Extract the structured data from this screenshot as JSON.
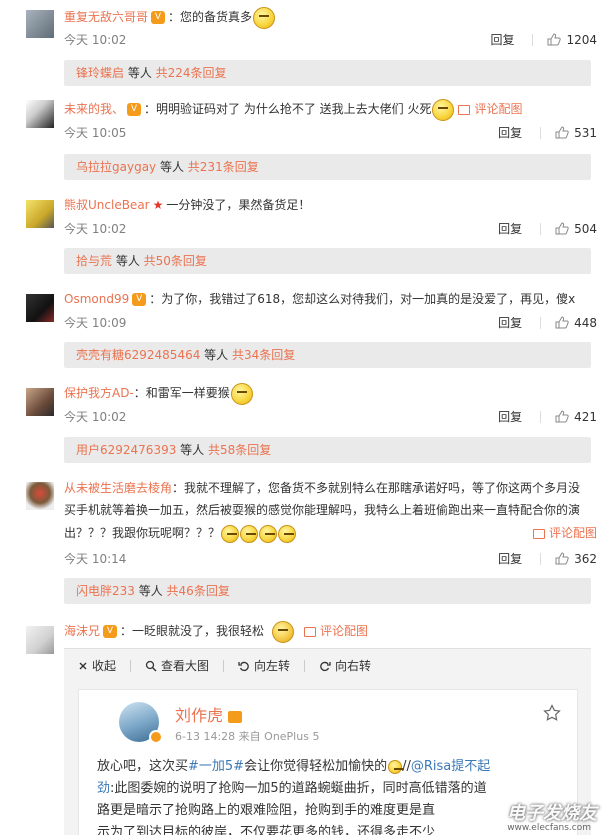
{
  "comments": [
    {
      "user": "重复无敌六哥哥",
      "text": "：您的备货真多",
      "time": "今天 10:02",
      "reply": "回复",
      "likes": "1204",
      "sub": {
        "user": "锋玲蝶启",
        "mid": " 等人 ",
        "count": "共224条回复"
      }
    },
    {
      "user": "未来的我、",
      "text": "：明明验证码对了 为什么抢不了 送我上去大佬们 火死",
      "pic_label": "评论配图",
      "time": "今天 10:05",
      "reply": "回复",
      "likes": "531",
      "sub": {
        "user": "乌拉拉gaygay",
        "mid": " 等人 ",
        "count": "共231条回复"
      }
    },
    {
      "user": "熊叔UncleBear",
      "text": "一分钟没了，果然备货足！",
      "time": "今天 10:02",
      "reply": "回复",
      "likes": "504",
      "sub": {
        "user": "拾与荒",
        "mid": " 等人 ",
        "count": "共50条回复"
      }
    },
    {
      "user": "Osmond99",
      "text": "：为了你，我错过了618，您却这么对待我们，对一加真的是没爱了，再见，傻x",
      "time": "今天 10:09",
      "reply": "回复",
      "likes": "448",
      "sub": {
        "user": "壳壳有糖6292485464",
        "mid": " 等人 ",
        "count": "共34条回复"
      }
    },
    {
      "user": "保护我方AD-",
      "text": "：和雷军一样要猴",
      "time": "今天 10:02",
      "reply": "回复",
      "likes": "421",
      "sub": {
        "user": "用户6292476393",
        "mid": " 等人 ",
        "count": "共58条回复"
      }
    },
    {
      "user": "从未被生活磨去棱角",
      "text_line1": "：我就不理解了，您备货不多就别特么在那瞎承诺好吗，等了你这两个多月没",
      "text_line2": "买手机就等着换一加五，然后被耍猴的感觉你能理解吗，我特么上着班偷跑出来一直特配合你的演",
      "text_line3": "出？？？我跟你玩呢啊？？？",
      "pic_label": "评论配图",
      "time": "今天 10:14",
      "reply": "回复",
      "likes": "362",
      "sub": {
        "user": "闪电胖233",
        "mid": " 等人 ",
        "count": "共46条回复"
      }
    },
    {
      "user": "海沫兄",
      "text": "：一眨眼就没了，我很轻松",
      "pic_label": "评论配图"
    }
  ],
  "photo_toolbar": {
    "collapse": "收起",
    "view_large": "查看大图",
    "rotate_left": "向左转",
    "rotate_right": "向右转"
  },
  "inner_post": {
    "name": "刘作虎",
    "meta": "6-13 14:28  来自 OnePlus 5",
    "line1_a": "放心吧，这次买",
    "line1_tag": "#一加5#",
    "line1_b": "会让你觉得轻松加愉快的",
    "line1_c": "//",
    "line1_at": "@Risa提不起",
    "line2_at": "劲",
    "line2": ":此图委婉的说明了抢购一加5的道路蜿蜒曲折，同时高低错落的道",
    "line3": "路更是暗示了抢购路上的艰难险阻，抢购到手的难度更是直",
    "line4": "示为了到达目标的彼岸，不仅要花更多的钱，还得多走不少"
  },
  "watermark": "电子发烧友",
  "watermark_url": "www.elecfans.com"
}
